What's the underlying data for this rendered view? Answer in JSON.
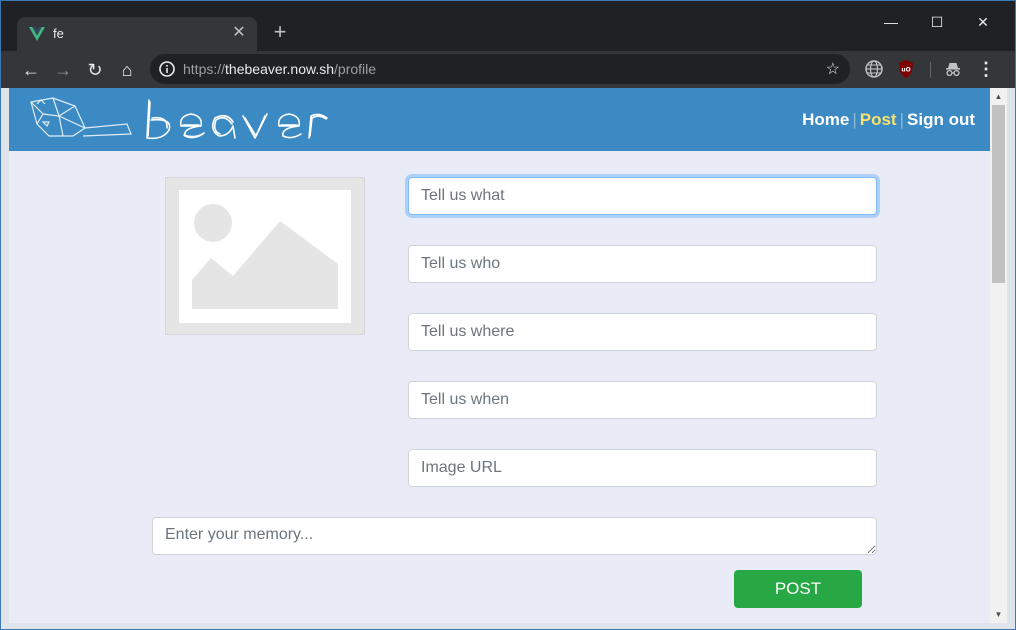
{
  "browser": {
    "tab": {
      "title": "fe",
      "close": "✕"
    },
    "new_tab": "+",
    "window_controls": {
      "minimize": "—",
      "maximize": "☐",
      "close": "✕"
    },
    "url": {
      "scheme": "https://",
      "host": "thebeaver.now.sh",
      "path": "/profile"
    },
    "nav": {
      "back": "←",
      "forward": "→",
      "reload": "↻",
      "home": "⌂"
    },
    "star": "☆",
    "menu": "⋮"
  },
  "header": {
    "nav": [
      {
        "label": "Home",
        "active": false
      },
      {
        "label": "Post",
        "active": true
      },
      {
        "label": "Sign out",
        "active": false
      }
    ],
    "separator": "|"
  },
  "form": {
    "what_placeholder": "Tell us what",
    "who_placeholder": "Tell us who",
    "where_placeholder": "Tell us where",
    "when_placeholder": "Tell us when",
    "image_url_placeholder": "Image URL",
    "memory_placeholder": "Enter your memory...",
    "post_label": "POST"
  },
  "colors": {
    "header": "#3b8ac4",
    "page_bg": "#e9ecf6",
    "active_nav": "#f7e06b",
    "post_button": "#28a745"
  }
}
